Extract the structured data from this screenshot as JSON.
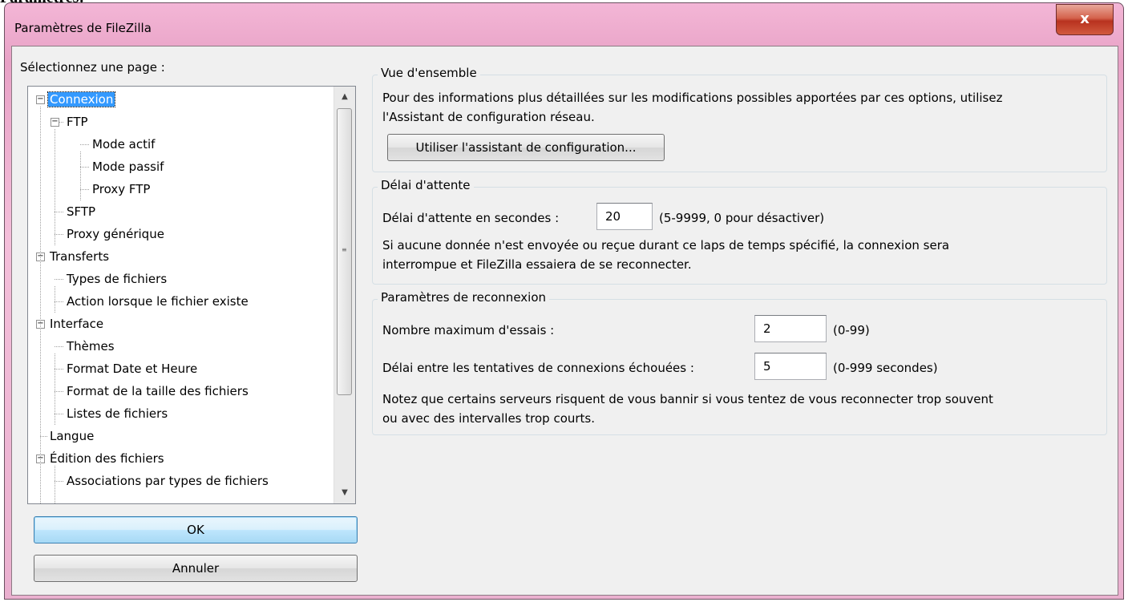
{
  "page": {
    "heading": "Paramètres:"
  },
  "window": {
    "title": "Paramètres de FileZilla",
    "close_label": "x"
  },
  "sidebar": {
    "label": "Sélectionnez une page :",
    "tree": [
      {
        "label": "Connexion",
        "level": 0,
        "expander": "minus",
        "selected": true
      },
      {
        "label": "FTP",
        "level": 1,
        "expander": "minus"
      },
      {
        "label": "Mode actif",
        "level": 2
      },
      {
        "label": "Mode passif",
        "level": 2
      },
      {
        "label": "Proxy FTP",
        "level": 2
      },
      {
        "label": "SFTP",
        "level": 1
      },
      {
        "label": "Proxy générique",
        "level": 1
      },
      {
        "label": "Transferts",
        "level": 0,
        "expander": "minus"
      },
      {
        "label": "Types de fichiers",
        "level": 1
      },
      {
        "label": "Action lorsque le fichier existe",
        "level": 1
      },
      {
        "label": "Interface",
        "level": 0,
        "expander": "minus"
      },
      {
        "label": "Thèmes",
        "level": 1
      },
      {
        "label": "Format Date et Heure",
        "level": 1
      },
      {
        "label": "Format de la taille des fichiers",
        "level": 1
      },
      {
        "label": "Listes de fichiers",
        "level": 1
      },
      {
        "label": "Langue",
        "level": 0
      },
      {
        "label": "Édition des fichiers",
        "level": 0,
        "expander": "minus"
      },
      {
        "label": "Associations par types de fichiers",
        "level": 1
      }
    ],
    "ok_label": "OK",
    "cancel_label": "Annuler"
  },
  "overview": {
    "title": "Vue d'ensemble",
    "text_line1": "Pour des informations plus détaillées sur les modifications possibles apportées par ces options, utilisez",
    "text_line2": "l'Assistant de configuration réseau.",
    "wizard_button": "Utiliser l'assistant de configuration..."
  },
  "timeout": {
    "title": "Délai d'attente",
    "label": "Délai d'attente en secondes :",
    "value": "20",
    "hint": "(5-9999, 0 pour désactiver)",
    "text_line1": "Si aucune donnée n'est envoyée ou reçue durant ce laps de temps spécifié, la connexion sera",
    "text_line2": "interrompue et FileZilla essaiera de se reconnecter."
  },
  "reconnect": {
    "title": "Paramètres de reconnexion",
    "max_label": "Nombre maximum d'essais :",
    "max_value": "2",
    "max_hint": "(0-99)",
    "delay_label": "Délai entre les tentatives de connexions échouées :",
    "delay_value": "5",
    "delay_hint": "(0-999 secondes)",
    "text_line1": "Notez que certains serveurs risquent de vous bannir si vous tentez de vous reconnecter trop souvent",
    "text_line2": "ou avec des intervalles trop courts."
  }
}
